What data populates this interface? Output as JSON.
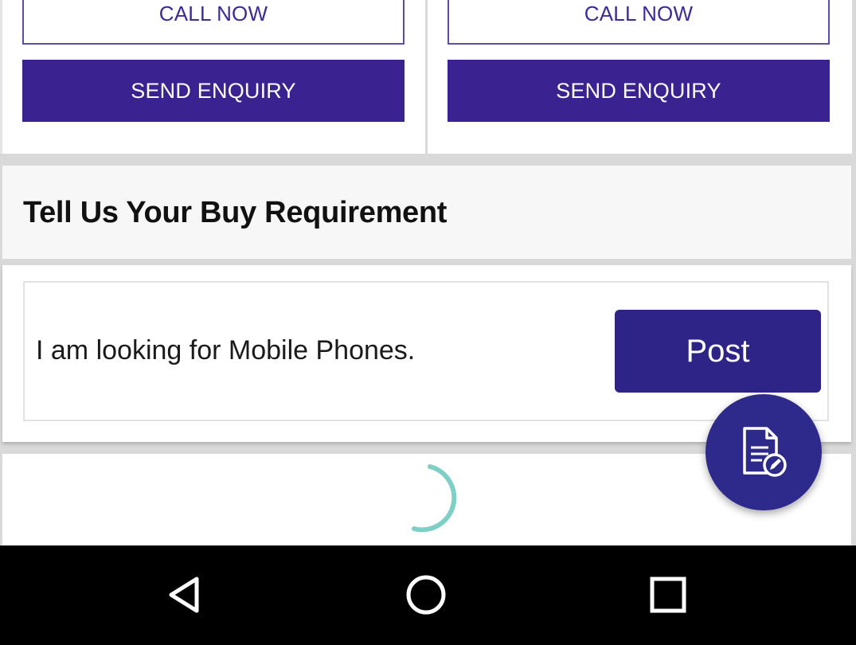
{
  "cards": [
    {
      "call_label": "CALL NOW",
      "enquiry_label": "SEND ENQUIRY"
    },
    {
      "call_label": "CALL NOW",
      "enquiry_label": "SEND ENQUIRY"
    }
  ],
  "requirement": {
    "title": "Tell Us Your Buy Requirement",
    "input_text": "I am looking for Mobile Phones.",
    "post_label": "Post"
  },
  "fab": {
    "icon": "post-requirement-icon"
  },
  "navbar": {
    "icons": [
      "back-icon",
      "home-icon",
      "recents-icon"
    ]
  },
  "colors": {
    "primary": "#3a2391",
    "post_button": "#2e2488",
    "fab": "#2e2a8c",
    "spinner": "#7ecfc5"
  }
}
